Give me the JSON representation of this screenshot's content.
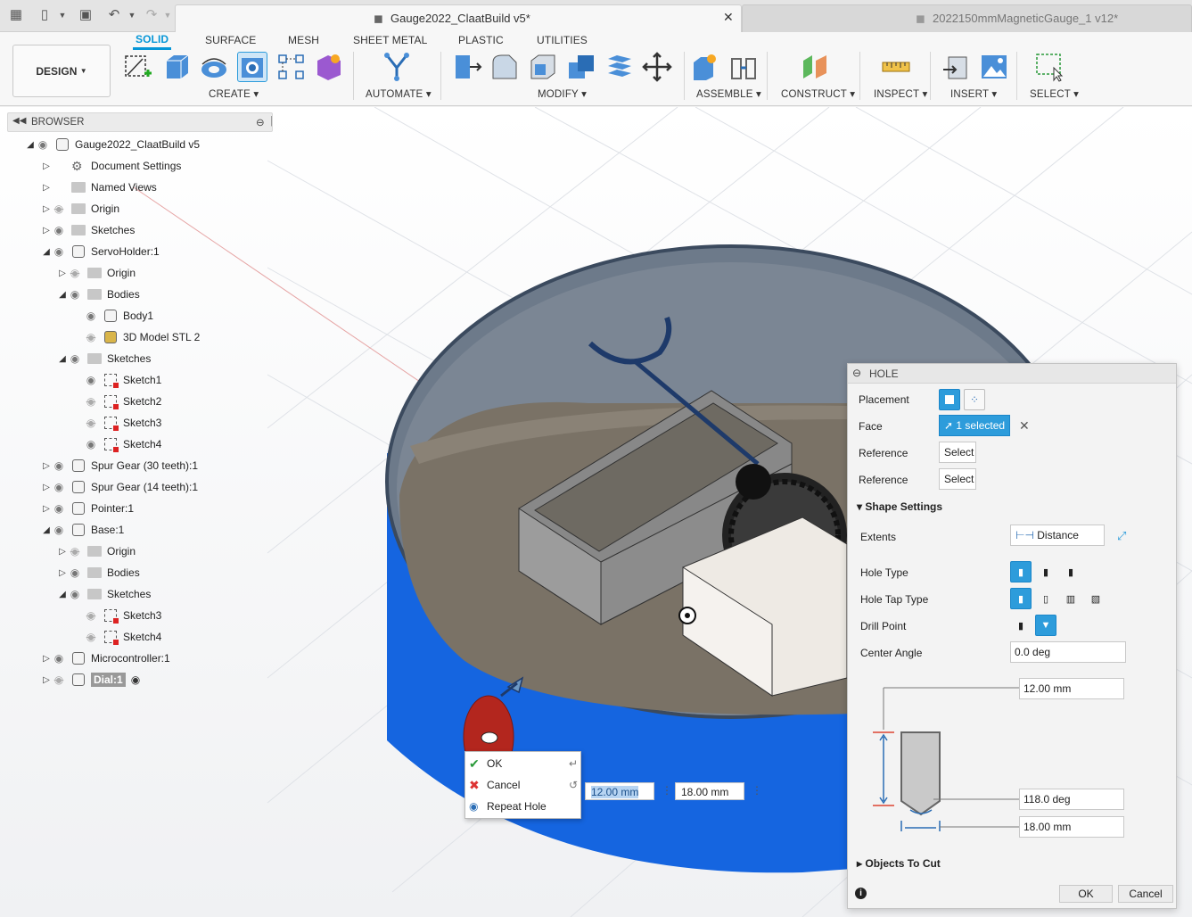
{
  "window": {
    "active_tab": "Gauge2022_ClaatBuild v5*",
    "inactive_tab": "2022150mmMagneticGauge_1 v12*"
  },
  "ribbon": {
    "workspace": "DESIGN",
    "tabs": [
      "SOLID",
      "SURFACE",
      "MESH",
      "SHEET METAL",
      "PLASTIC",
      "UTILITIES"
    ],
    "groups": [
      "CREATE",
      "AUTOMATE",
      "MODIFY",
      "ASSEMBLE",
      "CONSTRUCT",
      "INSPECT",
      "INSERT",
      "SELECT"
    ]
  },
  "browser": {
    "title": "BROWSER",
    "nodes": [
      {
        "label": "Gauge2022_ClaatBuild v5"
      },
      {
        "label": "Document Settings"
      },
      {
        "label": "Named Views"
      },
      {
        "label": "Origin"
      },
      {
        "label": "Sketches"
      },
      {
        "label": "ServoHolder:1"
      },
      {
        "label": "Origin"
      },
      {
        "label": "Bodies"
      },
      {
        "label": "Body1"
      },
      {
        "label": "3D Model STL 2"
      },
      {
        "label": "Sketches"
      },
      {
        "label": "Sketch1"
      },
      {
        "label": "Sketch2"
      },
      {
        "label": "Sketch3"
      },
      {
        "label": "Sketch4"
      },
      {
        "label": "Spur Gear (30 teeth):1"
      },
      {
        "label": "Spur Gear (14 teeth):1"
      },
      {
        "label": "Pointer:1"
      },
      {
        "label": "Base:1"
      },
      {
        "label": "Origin"
      },
      {
        "label": "Bodies"
      },
      {
        "label": "Sketches"
      },
      {
        "label": "Sketch3"
      },
      {
        "label": "Sketch4"
      },
      {
        "label": "Microcontroller:1"
      },
      {
        "label": "Dial:1"
      }
    ]
  },
  "hole_dialog": {
    "title": "HOLE",
    "placement_label": "Placement",
    "face_label": "Face",
    "face_value": "1 selected",
    "reference1_label": "Reference",
    "reference1_value": "Select",
    "reference2_label": "Reference",
    "reference2_value": "Select",
    "shape_settings": "Shape Settings",
    "extents_label": "Extents",
    "extents_value": "Distance",
    "hole_type_label": "Hole Type",
    "hole_tap_type_label": "Hole Tap Type",
    "drill_point_label": "Drill Point",
    "center_angle_label": "Center Angle",
    "center_angle_value": "0.0 deg",
    "diameter": "12.00 mm",
    "tip_angle": "118.0 deg",
    "depth": "18.00 mm",
    "objects_to_cut": "Objects To Cut",
    "ok": "OK",
    "cancel": "Cancel"
  },
  "context_menu": {
    "items": [
      "OK",
      "Cancel",
      "Repeat Hole"
    ]
  },
  "inline_inputs": {
    "diameter": "12.00 mm",
    "depth": "18.00 mm"
  },
  "colors": {
    "accent": "#0696d7",
    "body_blue": "#1565e0",
    "selected_face": "#b3261e"
  }
}
